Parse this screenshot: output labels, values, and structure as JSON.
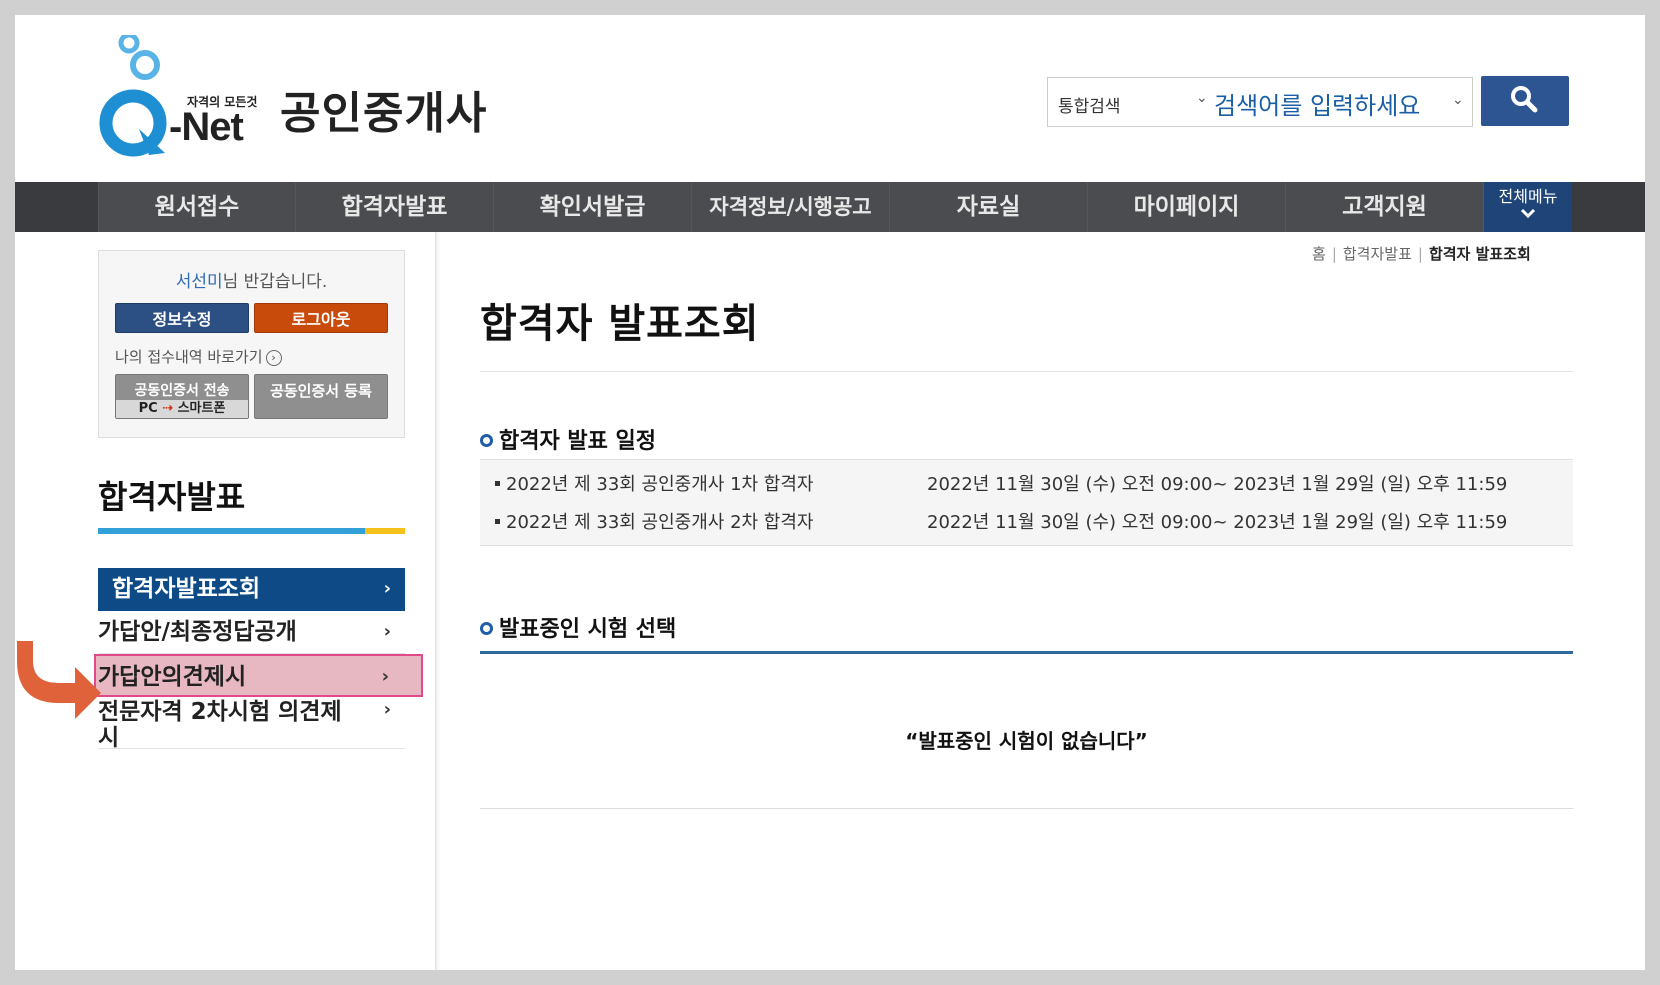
{
  "header": {
    "logo_tagline": "자격의 모든것",
    "logo_text": "-Net",
    "site_title": "공인중개사",
    "search_category": "통합검색",
    "search_placeholder": "검색어를 입력하세요"
  },
  "nav": {
    "items": [
      "원서접수",
      "합격자발표",
      "확인서발급",
      "자격정보/시행공고",
      "자료실",
      "마이페이지",
      "고객지원"
    ],
    "all_menu_label": "전체메뉴"
  },
  "user_box": {
    "user_name": "서선미",
    "greeting_suffix": "님 반갑습니다.",
    "edit_button": "정보수정",
    "logout_button": "로그아웃",
    "my_history_link": "나의 접수내역 바로가기",
    "cert_send_label": "공동인증서 전송",
    "cert_send_from": "PC",
    "cert_send_to": "스마트폰",
    "cert_register_label": "공동인증서 등록"
  },
  "sidebar": {
    "title": "합격자발표",
    "items": [
      {
        "label": "합격자발표조회",
        "chevron": "›"
      },
      {
        "label": "가답안/최종정답공개",
        "chevron": "›"
      },
      {
        "label": "가답안의견제시",
        "chevron": "›"
      },
      {
        "label": "전문자격 2차시험 의견제시",
        "chevron": "›"
      }
    ]
  },
  "breadcrumb": {
    "home": "홈",
    "level1": "합격자발표",
    "current": "합격자 발표조회"
  },
  "main": {
    "page_title": "합격자 발표조회",
    "schedule_title": "합격자 발표 일정",
    "schedule": [
      {
        "name": "2022년 제 33회 공인중개사 1차 합격자",
        "period": "2022년 11월 30일 (수) 오전 09:00~ 2023년 1월 29일 (일) 오후 11:59"
      },
      {
        "name": "2022년 제 33회 공인중개사 2차 합격자",
        "period": "2022년 11월 30일 (수) 오전 09:00~ 2023년 1월 29일 (일) 오후 11:59"
      }
    ],
    "exam_select_title": "발표중인 시험 선택",
    "empty_message": "“발표중인 시험이 없습니다”"
  },
  "colors": {
    "nav_bg": "#4b4c50",
    "accent_blue": "#0d4a86",
    "logout_orange": "#c84b0c",
    "highlight_pink": "#e7b8c2",
    "arrow_orange": "#e0623a"
  }
}
